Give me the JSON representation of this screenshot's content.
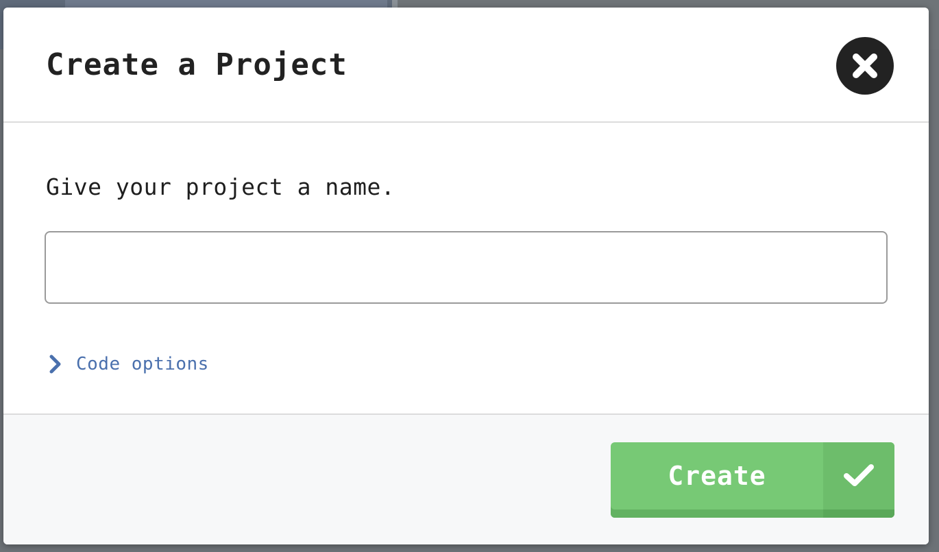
{
  "dialog": {
    "title": "Create a Project",
    "close_icon": "close-icon"
  },
  "body": {
    "prompt": "Give your project a name.",
    "name_input": {
      "value": "",
      "placeholder": ""
    },
    "code_options": {
      "label": "Code options",
      "icon": "chevron-right-icon",
      "expanded": false
    }
  },
  "footer": {
    "create_button": {
      "label": "Create",
      "icon": "checkmark-icon"
    }
  },
  "colors": {
    "title_text": "#222222",
    "link": "#4a70ad",
    "button_green": "#77c975",
    "button_green_dark": "#6dbd6b",
    "footer_bg": "#f7f8f9",
    "close_bg": "#222222"
  }
}
